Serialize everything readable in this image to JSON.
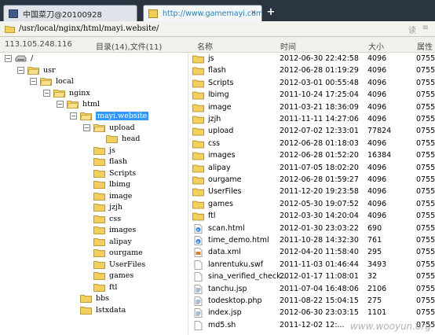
{
  "tabs": [
    {
      "label": "中国菜刀@20100928"
    },
    {
      "label": "http://www.gamemayi.com/m..."
    }
  ],
  "path": {
    "value": "/usr/local/nginx/html/mayi.website/",
    "read_label": "读",
    "dropdown_label": "▾",
    "extra_label": "≡"
  },
  "header": {
    "ip": "113.105.248.116",
    "summary": "目录(14),文件(11)",
    "col_name": "名称",
    "col_time": "时间",
    "col_size": "大小",
    "col_perm": "属性"
  },
  "tree": [
    {
      "label": "/",
      "icon": "drive-icon",
      "expanded": true
    },
    {
      "label": "usr",
      "icon": "folder-open-icon",
      "expanded": true
    },
    {
      "label": "local",
      "icon": "folder-open-icon",
      "expanded": true
    },
    {
      "label": "nginx",
      "icon": "folder-open-icon",
      "expanded": true
    },
    {
      "label": "html",
      "icon": "folder-open-icon",
      "expanded": true
    },
    {
      "label": "mayi.website",
      "icon": "folder-open-icon",
      "expanded": true,
      "selected": true
    },
    {
      "label": "upload",
      "icon": "folder-open-icon",
      "expanded": true
    },
    {
      "label": "head",
      "icon": "folder-icon",
      "expanded": false
    },
    {
      "label": "js",
      "icon": "folder-icon",
      "expanded": false
    },
    {
      "label": "flash",
      "icon": "folder-icon",
      "expanded": false
    },
    {
      "label": "Scripts",
      "icon": "folder-icon",
      "expanded": false
    },
    {
      "label": "lbimg",
      "icon": "folder-icon",
      "expanded": false
    },
    {
      "label": "image",
      "icon": "folder-icon",
      "expanded": false
    },
    {
      "label": "jzjh",
      "icon": "folder-icon",
      "expanded": false
    },
    {
      "label": "css",
      "icon": "folder-icon",
      "expanded": false
    },
    {
      "label": "images",
      "icon": "folder-icon",
      "expanded": false
    },
    {
      "label": "alipay",
      "icon": "folder-icon",
      "expanded": false
    },
    {
      "label": "ourgame",
      "icon": "folder-icon",
      "expanded": false
    },
    {
      "label": "UserFiles",
      "icon": "folder-icon",
      "expanded": false
    },
    {
      "label": "games",
      "icon": "folder-icon",
      "expanded": false
    },
    {
      "label": "ftl",
      "icon": "folder-icon",
      "expanded": false
    },
    {
      "label": "bbs",
      "icon": "folder-icon",
      "expanded": false
    },
    {
      "label": "lstxdata",
      "icon": "folder-icon",
      "expanded": false
    }
  ],
  "files": [
    {
      "name": "js",
      "time": "2012-06-30 22:42:58",
      "size": "4096",
      "perm": "0755",
      "icon": "folder-icon"
    },
    {
      "name": "flash",
      "time": "2012-06-28 01:19:29",
      "size": "4096",
      "perm": "0755",
      "icon": "folder-icon"
    },
    {
      "name": "Scripts",
      "time": "2012-03-01 00:55:48",
      "size": "4096",
      "perm": "0755",
      "icon": "folder-icon"
    },
    {
      "name": "lbimg",
      "time": "2011-10-24 17:25:04",
      "size": "4096",
      "perm": "0755",
      "icon": "folder-icon"
    },
    {
      "name": "image",
      "time": "2011-03-21 18:36:09",
      "size": "4096",
      "perm": "0755",
      "icon": "folder-icon"
    },
    {
      "name": "jzjh",
      "time": "2011-11-11 14:27:06",
      "size": "4096",
      "perm": "0755",
      "icon": "folder-icon"
    },
    {
      "name": "upload",
      "time": "2012-07-02 12:33:01",
      "size": "77824",
      "perm": "0755",
      "icon": "folder-icon"
    },
    {
      "name": "css",
      "time": "2012-06-28 01:18:03",
      "size": "4096",
      "perm": "0755",
      "icon": "folder-icon"
    },
    {
      "name": "images",
      "time": "2012-06-28 01:52:20",
      "size": "16384",
      "perm": "0755",
      "icon": "folder-icon"
    },
    {
      "name": "alipay",
      "time": "2011-07-05 18:02:20",
      "size": "4096",
      "perm": "0755",
      "icon": "folder-icon"
    },
    {
      "name": "ourgame",
      "time": "2012-06-28 01:59:27",
      "size": "4096",
      "perm": "0755",
      "icon": "folder-icon"
    },
    {
      "name": "UserFiles",
      "time": "2011-12-20 19:23:58",
      "size": "4096",
      "perm": "0755",
      "icon": "folder-icon"
    },
    {
      "name": "games",
      "time": "2012-05-30 19:07:52",
      "size": "4096",
      "perm": "0755",
      "icon": "folder-icon"
    },
    {
      "name": "ftl",
      "time": "2012-03-30 14:20:04",
      "size": "4096",
      "perm": "0755",
      "icon": "folder-icon"
    },
    {
      "name": "scan.html",
      "time": "2012-01-30 23:03:22",
      "size": "690",
      "perm": "0755",
      "icon": "html-file-icon"
    },
    {
      "name": "time_demo.html",
      "time": "2011-10-28 14:32:30",
      "size": "761",
      "perm": "0755",
      "icon": "html-file-icon"
    },
    {
      "name": "data.xml",
      "time": "2012-04-20 11:58:40",
      "size": "295",
      "perm": "0755",
      "icon": "xml-file-icon"
    },
    {
      "name": "lanrentuku.swf",
      "time": "2011-11-03 01:46:44",
      "size": "3493",
      "perm": "0755",
      "icon": "file-icon"
    },
    {
      "name": "sina_verified_check...",
      "time": "2012-01-17 11:08:01",
      "size": "32",
      "perm": "0755",
      "icon": "file-icon"
    },
    {
      "name": "tanchu.jsp",
      "time": "2011-07-04 16:48:06",
      "size": "2106",
      "perm": "0755",
      "icon": "script-file-icon"
    },
    {
      "name": "todesktop.php",
      "time": "2011-08-22 15:04:15",
      "size": "275",
      "perm": "0755",
      "icon": "script-file-icon"
    },
    {
      "name": "index.jsp",
      "time": "2012-06-30 23:03:15",
      "size": "1101",
      "perm": "0755",
      "icon": "script-file-icon"
    },
    {
      "name": "md5.sh",
      "time": "2011-12-02 12:...",
      "size": "",
      "perm": "0755",
      "icon": "file-icon"
    }
  ],
  "watermark": "www.wooyun.org",
  "colors": {
    "folder": "#f3cf5d",
    "selection": "#3399ff",
    "tabbar": "#2b3441"
  }
}
